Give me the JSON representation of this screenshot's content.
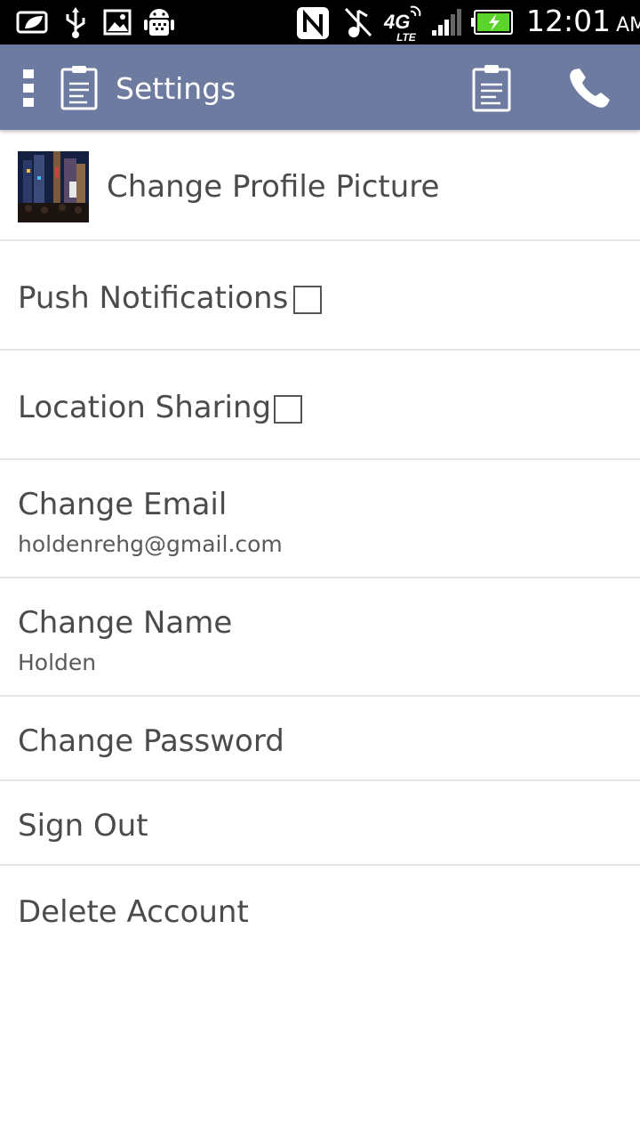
{
  "status_bar": {
    "time": "12:01",
    "ampm": "AM",
    "network": "4G LTE",
    "icons": [
      "status-leaf-icon",
      "usb-icon",
      "image-icon",
      "android-debug-icon",
      "nfc-icon",
      "mute-icon",
      "4g-lte-icon",
      "signal-icon",
      "battery-charging-icon"
    ]
  },
  "action_bar": {
    "title": "Settings",
    "icons": [
      "overflow-menu-icon",
      "clipboard-icon",
      "phone-icon"
    ],
    "color": "#6c7b9f"
  },
  "settings": {
    "profile_picture": {
      "label": "Change Profile Picture"
    },
    "push_notifications": {
      "label": "Push Notifications",
      "checked": false
    },
    "location_sharing": {
      "label": "Location Sharing",
      "checked": false
    },
    "change_email": {
      "label": "Change Email",
      "value": "holdenrehg@gmail.com"
    },
    "change_name": {
      "label": "Change Name",
      "value": "Holden"
    },
    "change_password": {
      "label": "Change Password"
    },
    "sign_out": {
      "label": "Sign Out"
    },
    "delete_account": {
      "label": "Delete Account"
    }
  }
}
